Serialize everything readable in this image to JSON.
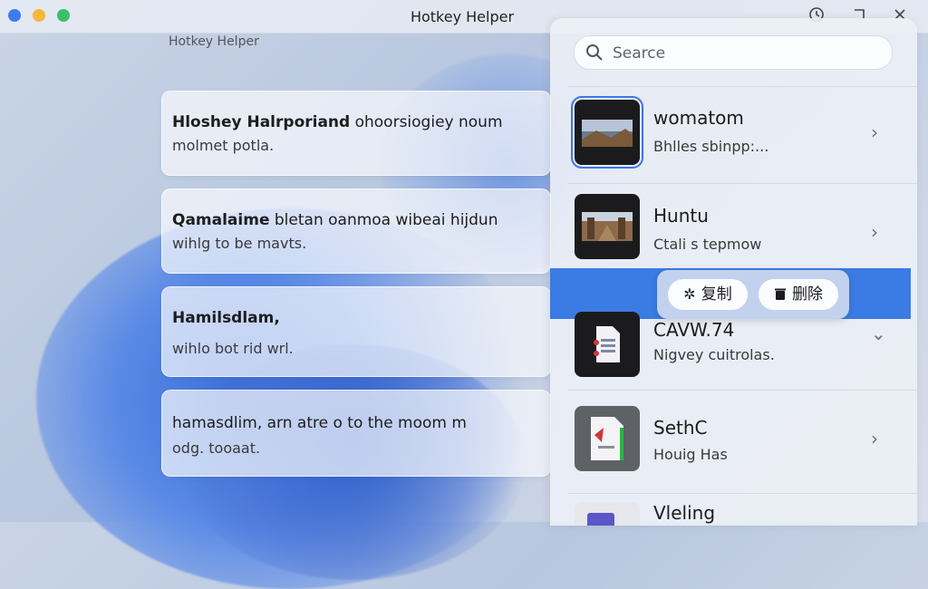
{
  "window": {
    "title": "Hotkey Helper",
    "subtitle": "Hotkey Helper"
  },
  "left_cards": [
    {
      "line1_bold": "Hloshey Halrporiand",
      "line1_rest": " ohoorsiogiey noum",
      "line2": "molmet potla."
    },
    {
      "line1_bold": "Qamalaime",
      "line1_rest": " bletan oanmoa wibeai hijdun",
      "line2": "wihlg to be mavts."
    },
    {
      "line1_bold": "Hamilsdlam,",
      "line1_rest": "",
      "line2": "wihlo bot rid wrl."
    },
    {
      "line1_bold": "",
      "line1_rest": "hamasdlim, arn atre o to the moom m",
      "line2": "odg. tooaat."
    }
  ],
  "search": {
    "placeholder": "Searce"
  },
  "items": [
    {
      "name": "womatom",
      "desc": "Bhlles sbinpp:...",
      "thumb": "photo-landscape",
      "chevron": "›"
    },
    {
      "name": "Huntu",
      "desc": "Ctali s tepmow",
      "thumb": "photo-ruins",
      "chevron": "›"
    },
    {
      "name": "CAVW.74",
      "desc": "Nigvey cuitrolas.",
      "thumb": "document-icon",
      "chevron": "⌄"
    },
    {
      "name": "SethC",
      "desc": "Houig Has",
      "thumb": "pdf-icon",
      "chevron": "›"
    },
    {
      "name": "Vleling",
      "desc": "",
      "thumb": "folder-icon",
      "chevron": ""
    }
  ],
  "actions": {
    "copy_label": "复制",
    "delete_label": "删除"
  },
  "colors": {
    "accent": "#3b7be4",
    "close": "#3f7bf0",
    "minimize": "#f6b73c",
    "maximize": "#3ac06a"
  }
}
